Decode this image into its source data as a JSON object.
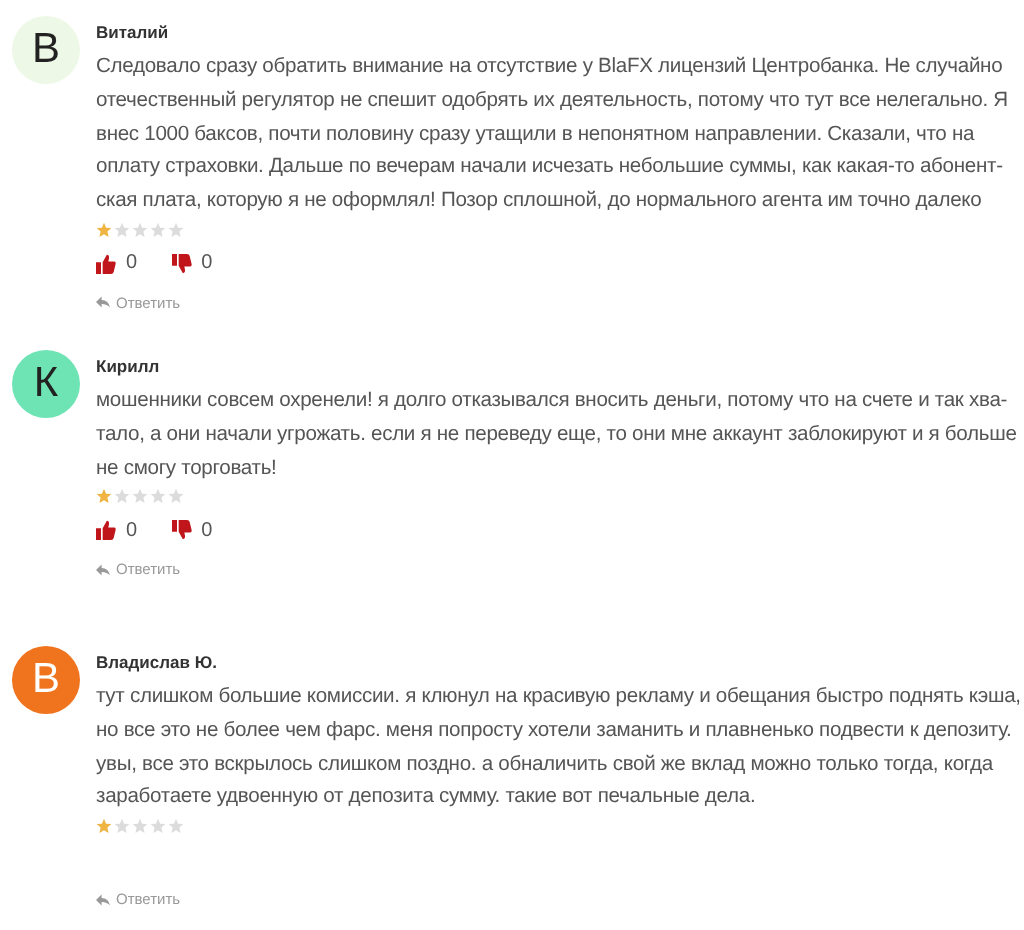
{
  "reviews": [
    {
      "initial": "В",
      "color": "#eef8e6",
      "name": "Виталий",
      "lines": [
        "Следовало сразу обратить внимание на отсутствие у BlaFX лицензий Центробанка. Не случайно",
        "отечественный регулятор не спешит одобрять их деятельность, потому что тут все нелегально. Я",
        "внес 1000 баксов, почти половину сразу утащили в непонятном направлении. Сказали, что на",
        "оплату страховки. Дальше по вечерам начали исчезать небольшие суммы, как какая-то абонент-",
        "ская плата, которую я не оформлял! Позор сплошной, до нормального агента им точно далеко"
      ],
      "stars": 1,
      "likes": "0",
      "dislikes": "0",
      "reply": "Ответить"
    },
    {
      "initial": "К",
      "color": "#6ee3b4",
      "name": "Кирилл",
      "lines": [
        "мошенники совсем охренели! я долго отказывался вносить деньги, потому что на счете и так хва-",
        "тало, а они начали угрожать. если я не переведу еще, то они мне аккаунт заблокируют и я больше",
        "не смогу торговать!"
      ],
      "stars": 1,
      "likes": "0",
      "dislikes": "0",
      "reply": "Ответить"
    },
    {
      "initial": "В",
      "color": "#f0731e",
      "name": "Владислав Ю.",
      "lines": [
        "тут слишком большие комиссии. я клюнул на красивую рекламу и обещания быстро поднять кэша,",
        "но все это не более чем фарс. меня попросту хотели заманить и плавненько подвести к депозиту.",
        "увы, все это вскрылось слишком поздно. а обналичить свой же вклад можно только тогда, когда",
        "заработаете удвоенную от депозита сумму. такие вот печальные дела."
      ],
      "stars": 1,
      "reply": "Ответить"
    }
  ]
}
